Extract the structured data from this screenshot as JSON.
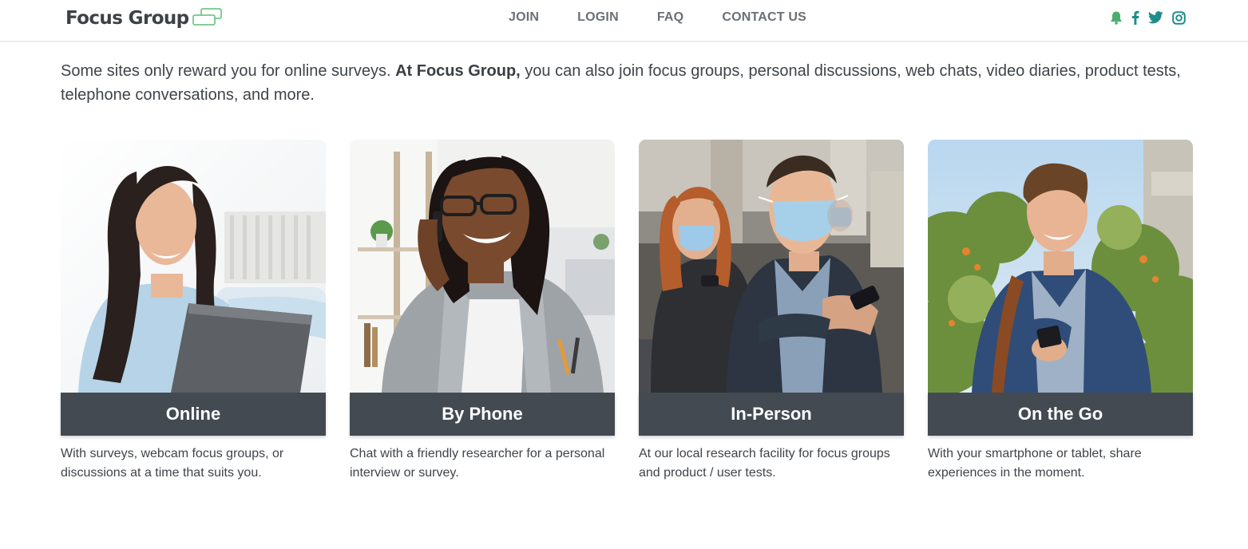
{
  "brand": {
    "name": "Focus Group",
    "accent": "#1f8c8c",
    "logo_mark_color": "#5cbf74"
  },
  "nav": {
    "items": [
      "JOIN",
      "LOGIN",
      "FAQ",
      "CONTACT US"
    ]
  },
  "social": {
    "icons": [
      "bell-icon",
      "facebook-icon",
      "twitter-icon",
      "instagram-icon"
    ],
    "bell_color": "#4caf6e",
    "icon_color": "#1f8c8c"
  },
  "intro": {
    "before": "Some sites only reward you for online surveys. ",
    "bold": "At Focus Group,",
    "after": " you can also join focus groups, personal discussions, web chats, video diaries, product tests, telephone conversations, and more."
  },
  "cards": [
    {
      "title": "Online",
      "description": "With surveys, webcam focus groups, or discussions at a time that suits you."
    },
    {
      "title": "By Phone",
      "description": "Chat with a friendly researcher for a personal interview or survey."
    },
    {
      "title": "In-Person",
      "description": "At our local research facility for focus groups and product / user tests."
    },
    {
      "title": "On the Go",
      "description": "With your smartphone or tablet, share experiences in the moment."
    }
  ]
}
